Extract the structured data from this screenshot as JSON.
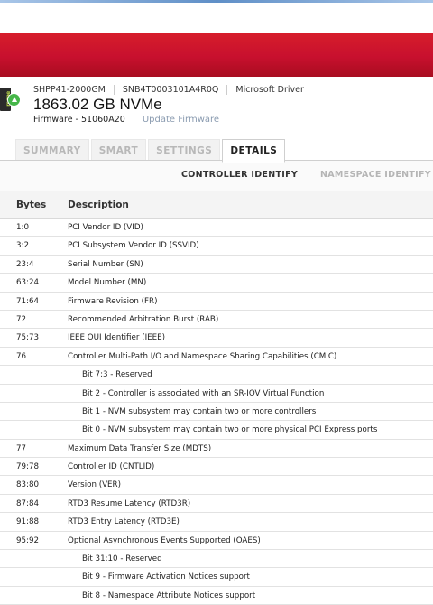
{
  "device": {
    "model": "SHPP41-2000GM",
    "serial": "SNB4T0003101A4R0Q",
    "driver": "Microsoft Driver",
    "capacity": "1863.02 GB NVMe",
    "firmware_label": "Firmware - 51060A20",
    "update_firmware": "Update Firmware",
    "icon_text": "nvme"
  },
  "tabs": [
    "SUMMARY",
    "SMART",
    "SETTINGS",
    "DETAILS"
  ],
  "active_tab": "DETAILS",
  "subtabs": {
    "controller": "CONTROLLER IDENTIFY",
    "namespace": "NAMESPACE IDENTIFY"
  },
  "table": {
    "headers": {
      "bytes": "Bytes",
      "description": "Description"
    },
    "rows": [
      {
        "bytes": "1:0",
        "desc": "PCI Vendor ID (VID)"
      },
      {
        "bytes": "3:2",
        "desc": "PCI Subsystem Vendor ID (SSVID)"
      },
      {
        "bytes": "23:4",
        "desc": "Serial Number (SN)"
      },
      {
        "bytes": "63:24",
        "desc": "Model Number (MN)"
      },
      {
        "bytes": "71:64",
        "desc": "Firmware Revision (FR)"
      },
      {
        "bytes": "72",
        "desc": "Recommended Arbitration Burst (RAB)"
      },
      {
        "bytes": "75:73",
        "desc": "IEEE OUI Identifier (IEEE)"
      },
      {
        "bytes": "76",
        "desc": "Controller Multi-Path I/O and Namespace Sharing Capabilities (CMIC)"
      },
      {
        "bytes": "",
        "desc": "Bit 7:3 - Reserved",
        "sub": true
      },
      {
        "bytes": "",
        "desc": "Bit 2 - Controller is associated with an SR-IOV Virtual Function",
        "sub": true
      },
      {
        "bytes": "",
        "desc": "Bit 1 - NVM subsystem may contain two or more controllers",
        "sub": true
      },
      {
        "bytes": "",
        "desc": "Bit 0 - NVM subsystem may contain two or more physical PCI Express ports",
        "sub": true
      },
      {
        "bytes": "77",
        "desc": "Maximum Data Transfer Size (MDTS)"
      },
      {
        "bytes": "79:78",
        "desc": "Controller ID (CNTLID)"
      },
      {
        "bytes": "83:80",
        "desc": "Version (VER)"
      },
      {
        "bytes": "87:84",
        "desc": "RTD3 Resume Latency (RTD3R)"
      },
      {
        "bytes": "91:88",
        "desc": "RTD3 Entry Latency (RTD3E)"
      },
      {
        "bytes": "95:92",
        "desc": "Optional Asynchronous Events Supported (OAES)"
      },
      {
        "bytes": "",
        "desc": "Bit 31:10 - Reserved",
        "sub": true
      },
      {
        "bytes": "",
        "desc": "Bit 9 - Firmware Activation Notices support",
        "sub": true
      },
      {
        "bytes": "",
        "desc": "Bit 8 - Namespace Attribute Notices support",
        "sub": true
      }
    ]
  }
}
